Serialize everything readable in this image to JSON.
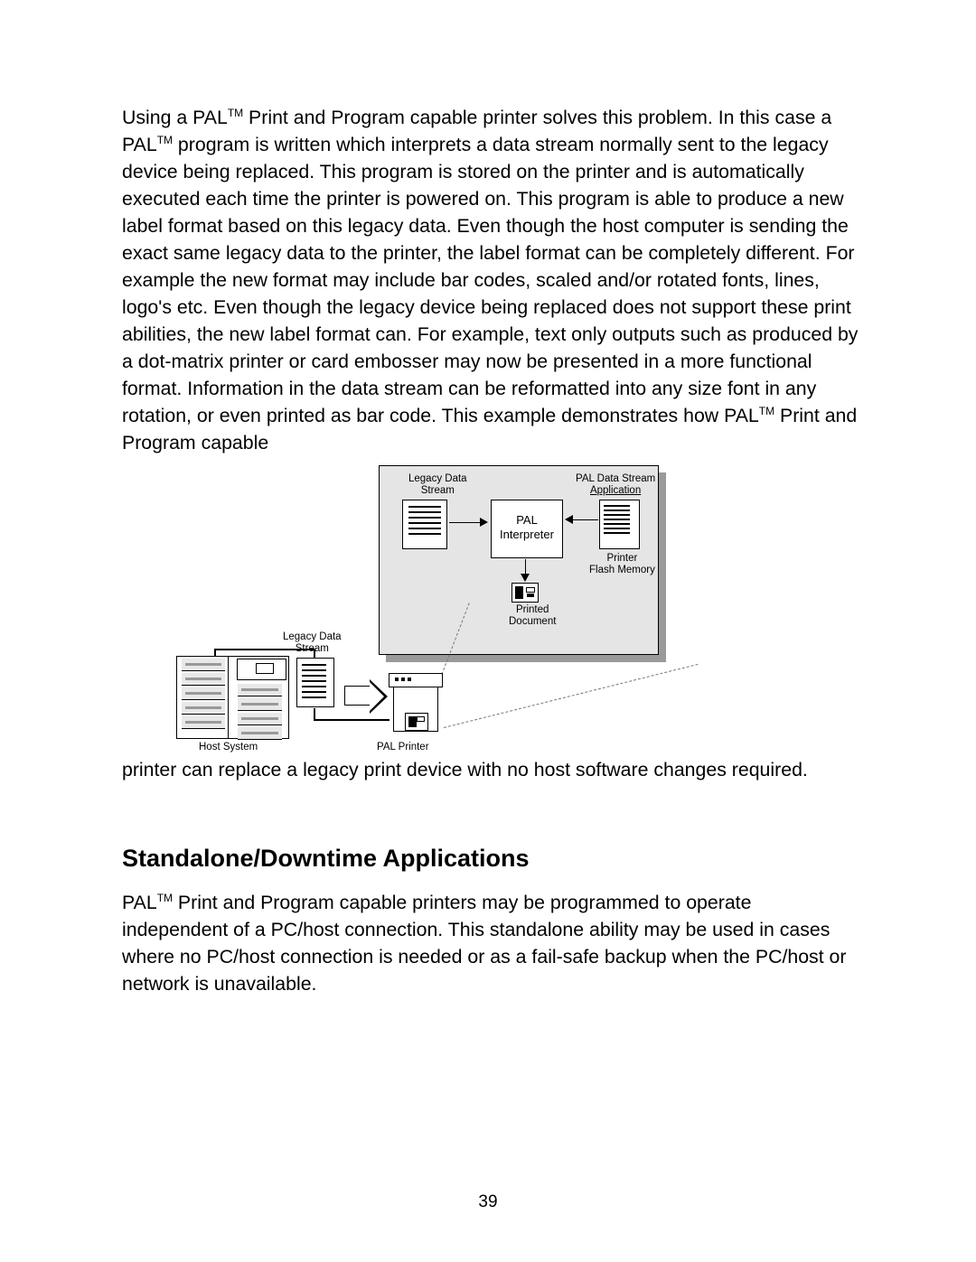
{
  "para1_a": "Using a PAL",
  "tm": "TM",
  "para1_b": " Print and Program capable printer solves this problem.  In this case a PAL",
  "para1_c": " program is written which interprets a data stream normally sent to the legacy device being replaced.  This program is stored on the printer and is automatically executed each time the printer is powered on.  This program is able to produce a new label format based on this legacy data.  Even though the host computer is sending the exact same legacy data to the printer, the label format can be completely different.  For example the new format may include bar codes, scaled and/or rotated fonts, lines, logo's etc.  Even though the legacy device being replaced does not support these print abilities, the new label format can.  For example, text only outputs such as produced by a dot-matrix printer or card embosser may now be presented in a more functional format.  Information in the data stream can be reformatted into any size font in any rotation, or even printed as bar code. This example demonstrates how PAL",
  "para1_d": " Print and Program capable ",
  "para1_e": "printer can replace a legacy print device with no host software changes required.",
  "heading": "Standalone/Downtime Applications",
  "para2_a": "PAL",
  "para2_b": " Print and Program capable printers may be programmed to operate independent of a PC/host connection.  This standalone ability may be used in cases where no PC/host connection is needed or as a fail-safe backup when the PC/host or network is unavailable.",
  "pageNumber": "39",
  "diagram": {
    "legacyDataStream1": "Legacy Data",
    "legacyDataStream2": "Stream",
    "palDataStream1": "PAL Data Stream",
    "palDataStream2": "Application",
    "interpreter1": "PAL",
    "interpreter2": "Interpreter",
    "printerFlash1": "Printer",
    "printerFlash2": "Flash Memory",
    "printedDoc1": "Printed",
    "printedDoc2": "Document",
    "hostSystem": "Host System",
    "palPrinter": "PAL Printer",
    "midLegacy1": "Legacy Data",
    "midLegacy2": "Stream"
  }
}
